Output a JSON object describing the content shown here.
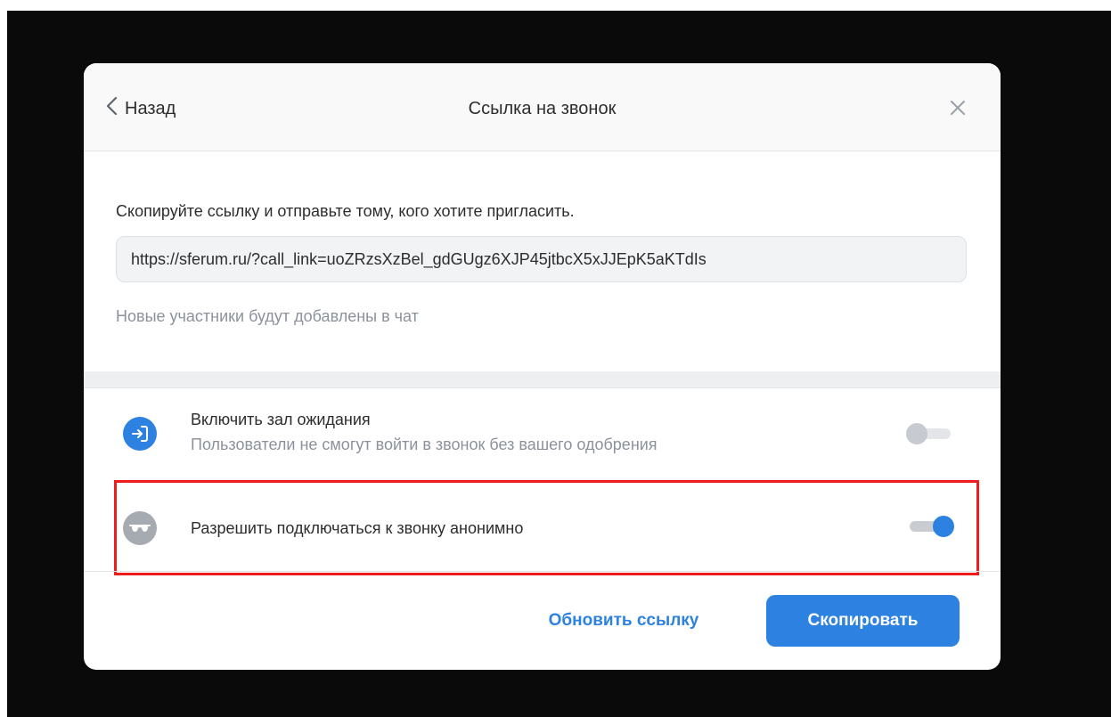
{
  "header": {
    "back_label": "Назад",
    "title": "Ссылка на звонок",
    "back_icon": "chevron-left-icon",
    "close_icon": "close-icon"
  },
  "body": {
    "instruction": "Скопируйте ссылку и отправьте тому, кого хотите пригласить.",
    "link_value": "https://sferum.ru/?call_link=uoZRzsXzBel_gdGUgz6XJP45jtbcX5xJJEpK5aKTdIs",
    "hint": "Новые участники будут добавлены в чат"
  },
  "options": [
    {
      "title": "Включить зал ожидания",
      "subtitle": "Пользователи не смогут войти в звонок без вашего одобрения",
      "icon": "enter-door-icon",
      "enabled": false
    },
    {
      "title": "Разрешить подключаться к звонку анонимно",
      "icon": "incognito-icon",
      "enabled": true
    }
  ],
  "footer": {
    "refresh_label": "Обновить ссылку",
    "copy_label": "Скопировать"
  },
  "colors": {
    "accent": "#2d81e0",
    "highlight": "#ee1c1c",
    "muted_text": "#8c929b"
  }
}
